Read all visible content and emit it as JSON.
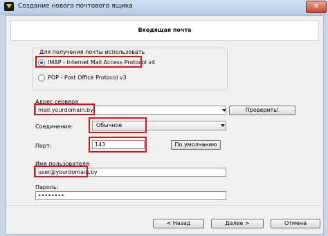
{
  "window": {
    "title": "Создание нового почтового ящика",
    "close_glyph": "✕"
  },
  "header": {
    "title": "Входящая почта"
  },
  "protocol_group": {
    "label": "Для получения почты использовать",
    "options": [
      {
        "label": "IMAP - Internet Mail Access Protocol v4",
        "checked": true
      },
      {
        "label": "POP - Post Office Protocol v3",
        "checked": false
      }
    ]
  },
  "server": {
    "label": "Адрес сервера",
    "value": "mail.yourdomain.by",
    "check_button": "Проверить!"
  },
  "connection": {
    "label": "Соединение:",
    "selected": "Обычное"
  },
  "port": {
    "label": "Порт:",
    "value": "143",
    "default_button": "По умолчанию"
  },
  "username": {
    "label": "Имя пользователя:",
    "value": "user@yourdomain.by"
  },
  "password": {
    "label": "Пароль:",
    "value": "••••••••"
  },
  "buttons": {
    "back": "< Назад",
    "next": "Далее >",
    "cancel": "Отмена"
  },
  "highlight_color": "#d8141a"
}
